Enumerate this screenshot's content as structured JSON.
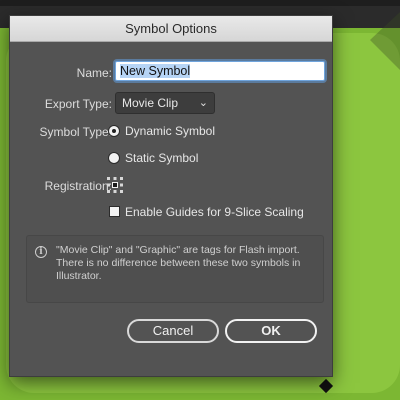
{
  "dialog": {
    "title": "Symbol Options",
    "name_label": "Name:",
    "name_value": "New Symbol",
    "export_type_label": "Export Type:",
    "export_type_value": "Movie Clip",
    "symbol_type_label": "Symbol Type:",
    "symbol_type_options": [
      {
        "label": "Dynamic Symbol",
        "selected": true
      },
      {
        "label": "Static Symbol",
        "selected": false
      }
    ],
    "registration_label": "Registration:",
    "nine_slice_label": "Enable Guides for 9-Slice Scaling",
    "nine_slice_checked": false,
    "info_text": "\"Movie Clip\" and \"Graphic\" are tags for Flash import. There is no difference between these two symbols in Illustrator.",
    "cancel_label": "Cancel",
    "ok_label": "OK"
  },
  "colors": {
    "artboard_green": "#8cc63f",
    "dialog_bg": "#535353",
    "focus_ring": "#6fa4dc"
  }
}
